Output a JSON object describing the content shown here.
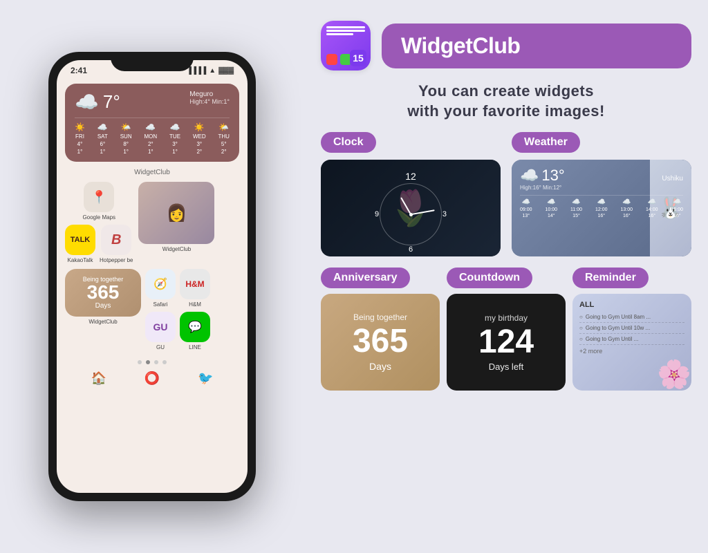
{
  "app": {
    "name": "WidgetClub",
    "tagline_line1": "You can create widgets",
    "tagline_line2": "with your favorite images!"
  },
  "phone": {
    "time": "2:41",
    "weather_widget": {
      "temp": "7°",
      "location": "Meguro",
      "high": "High:4°",
      "min": "Min:1°",
      "forecast": [
        {
          "day": "FRI",
          "icon": "☀️",
          "high": "4°",
          "low": "1°"
        },
        {
          "day": "SAT",
          "icon": "☁️",
          "high": "6°",
          "low": "1°"
        },
        {
          "day": "SUN",
          "icon": "🌤️",
          "high": "8°",
          "low": "1°"
        },
        {
          "day": "MON",
          "icon": "☁️",
          "high": "2°",
          "low": "1°"
        },
        {
          "day": "TUE",
          "icon": "☁️",
          "high": "3°",
          "low": "1°"
        },
        {
          "day": "WED",
          "icon": "☀️",
          "high": "3°",
          "low": "2°"
        },
        {
          "day": "THU",
          "icon": "🌤️",
          "high": "5°",
          "low": "2°"
        }
      ]
    },
    "widgetclub_label": "WidgetClub",
    "apps": [
      {
        "name": "Google Maps",
        "icon": "📍"
      },
      {
        "name": "",
        "icon": ""
      },
      {
        "name": "",
        "icon": ""
      },
      {
        "name": "KakaoTalk",
        "icon": "K"
      },
      {
        "name": "Hotpepper be",
        "icon": "B"
      },
      {
        "name": "WidgetClub",
        "icon": "W"
      }
    ],
    "being_together": {
      "label": "Being together",
      "days": "365",
      "unit": "Days"
    },
    "bottom_apps": [
      {
        "name": "WidgetClub"
      },
      {
        "name": "GU"
      },
      {
        "name": "LINE"
      }
    ]
  },
  "widget_types": {
    "clock": {
      "label": "Clock",
      "time_12": "12",
      "time_9": "9",
      "time_3": "3",
      "time_6": "6"
    },
    "weather": {
      "label": "Weather",
      "temp": "13°",
      "location": "Ushiku",
      "high": "High:16°",
      "min": "Min:12°",
      "times": [
        "09:00",
        "10:00",
        "11:00",
        "12:00",
        "13:00",
        "14:00",
        "15:00"
      ],
      "temps": [
        "13°",
        "14°",
        "15°",
        "16°",
        "16°",
        "16°",
        "16°"
      ]
    },
    "anniversary": {
      "label": "Anniversary",
      "sublabel": "Being together",
      "days": "365",
      "unit": "Days"
    },
    "countdown": {
      "label": "Countdown",
      "sublabel": "my birthday",
      "days": "124",
      "unit": "Days left"
    },
    "reminder": {
      "label": "Reminder",
      "title": "ALL",
      "items": [
        "Going to Gym Until 8am ...",
        "Going to Gym Until 10w ...",
        "Going to Gym Until ..."
      ],
      "more": "+2 more"
    }
  }
}
